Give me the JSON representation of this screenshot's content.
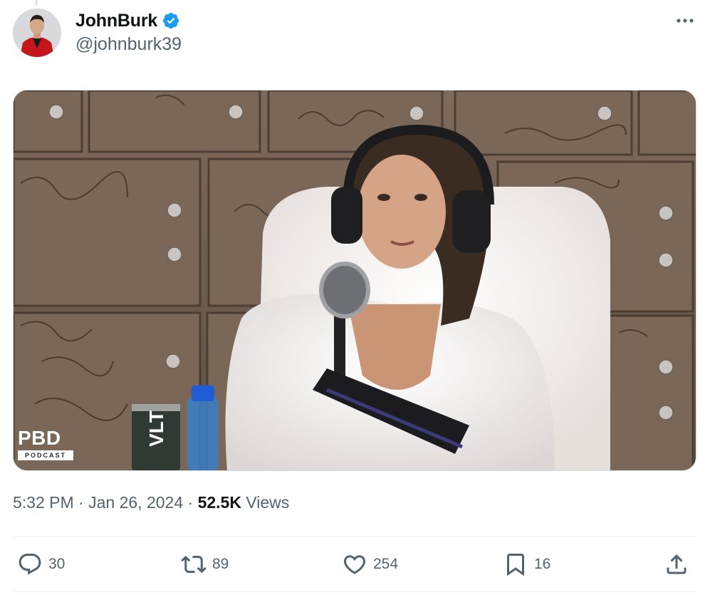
{
  "author": {
    "display_name": "JohnBurk",
    "handle": "@johnburk39",
    "verified": true
  },
  "media": {
    "watermark_top": "PBD",
    "watermark_bottom": "PODCAST",
    "description_icons": [
      "play-video"
    ]
  },
  "meta": {
    "time": "5:32 PM",
    "separator": "·",
    "date": "Jan 26, 2024",
    "views_count": "52.5K",
    "views_label": "Views"
  },
  "actions": {
    "replies": "30",
    "reposts": "89",
    "likes": "254",
    "bookmarks": "16"
  },
  "colors": {
    "verified_blue": "#1d9bf0",
    "text_primary": "#0f1419",
    "text_secondary": "#536471",
    "divider": "#eff3f4"
  }
}
